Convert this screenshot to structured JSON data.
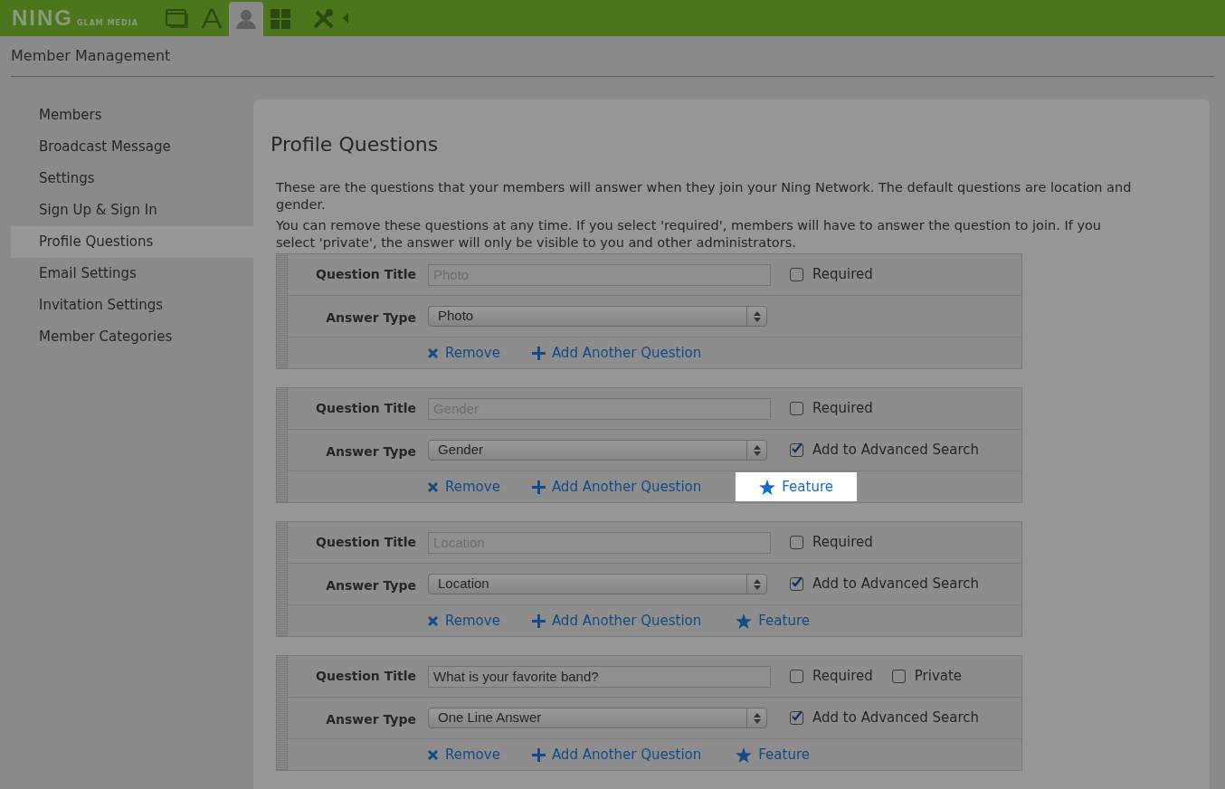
{
  "topbar": {
    "logo": "NING",
    "logo_sub": "GLAM MEDIA",
    "icons": [
      {
        "kind": "window",
        "selected": false
      },
      {
        "kind": "app",
        "selected": false
      },
      {
        "kind": "person",
        "selected": true
      },
      {
        "kind": "grid",
        "selected": false
      },
      {
        "kind": "tools",
        "selected": false
      }
    ]
  },
  "page_title": "Member Management",
  "sidebar": {
    "items": [
      {
        "label": "Members",
        "selected": false
      },
      {
        "label": "Broadcast Message",
        "selected": false
      },
      {
        "label": "Settings",
        "selected": false
      },
      {
        "label": "Sign Up & Sign In",
        "selected": false
      },
      {
        "label": "Profile Questions",
        "selected": true
      },
      {
        "label": "Email Settings",
        "selected": false
      },
      {
        "label": "Invitation Settings",
        "selected": false
      },
      {
        "label": "Member Categories",
        "selected": false
      }
    ]
  },
  "panel": {
    "title": "Profile Questions",
    "paragraphs": [
      "These are the questions that your members will answer when they join your Ning Network. The default questions are location and gender.",
      "You can remove these questions at any time. If you select 'required', members will have to answer the question to join. If you select 'private', the answer will only be visible to you and other administrators."
    ],
    "questions": [
      {
        "title_label": "Question Title",
        "title_value": "Photo",
        "disabled": true,
        "options": [
          {
            "label": "Required",
            "checked": false
          }
        ],
        "answer_label": "Answer Type",
        "answer_type": "Photo",
        "actions": [
          {
            "kind": "remove",
            "label": "Remove",
            "highlighted": false
          },
          {
            "kind": "add",
            "label": "Add Another Question",
            "highlighted": false
          }
        ]
      },
      {
        "title_label": "Question Title",
        "title_value": "Gender",
        "disabled": true,
        "options": [
          {
            "label": "Required",
            "checked": false
          }
        ],
        "answer_label": "Answer Type",
        "answer_type": "Gender",
        "extras": [
          {
            "label": "Add to Advanced Search",
            "checked": true
          }
        ],
        "actions": [
          {
            "kind": "remove",
            "label": "Remove",
            "highlighted": false
          },
          {
            "kind": "add",
            "label": "Add Another Question",
            "highlighted": false
          },
          {
            "kind": "feature",
            "label": "Feature",
            "highlighted": true
          }
        ]
      },
      {
        "title_label": "Question Title",
        "title_value": "Location",
        "disabled": true,
        "options": [
          {
            "label": "Required",
            "checked": false
          }
        ],
        "answer_label": "Answer Type",
        "answer_type": "Location",
        "extras": [
          {
            "label": "Add to Advanced Search",
            "checked": true
          }
        ],
        "actions": [
          {
            "kind": "remove",
            "label": "Remove",
            "highlighted": false
          },
          {
            "kind": "add",
            "label": "Add Another Question",
            "highlighted": false
          },
          {
            "kind": "feature",
            "label": "Feature",
            "highlighted": false
          }
        ]
      },
      {
        "title_label": "Question Title",
        "title_value": "What is your favorite band?",
        "disabled": false,
        "options": [
          {
            "label": "Required",
            "checked": false
          },
          {
            "label": "Private",
            "checked": false
          }
        ],
        "answer_label": "Answer Type",
        "answer_type": "One Line Answer",
        "extras": [
          {
            "label": "Add to Advanced Search",
            "checked": true
          }
        ],
        "actions": [
          {
            "kind": "remove",
            "label": "Remove",
            "highlighted": false
          },
          {
            "kind": "add",
            "label": "Add Another Question",
            "highlighted": false
          },
          {
            "kind": "feature",
            "label": "Feature",
            "highlighted": false
          }
        ]
      }
    ]
  }
}
